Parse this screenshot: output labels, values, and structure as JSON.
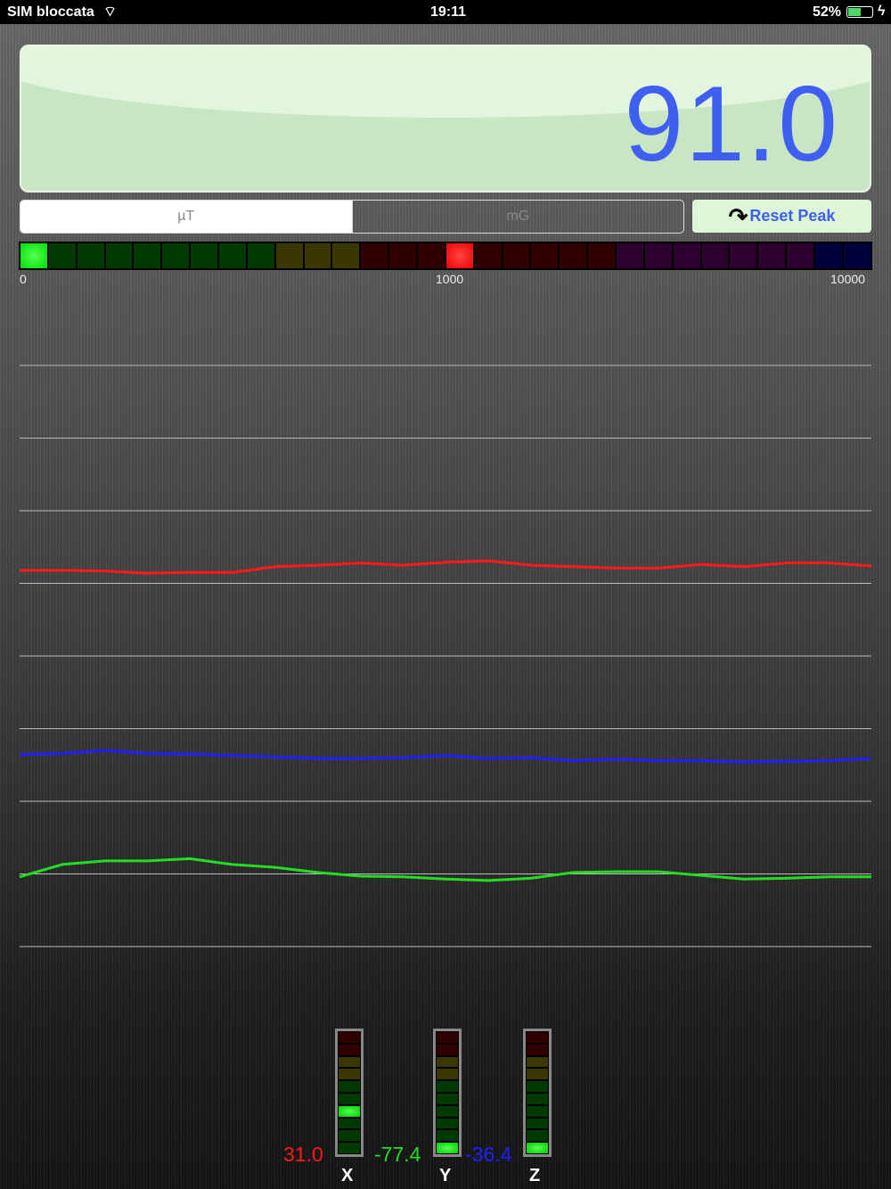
{
  "status": {
    "carrier": "SIM bloccata",
    "time": "19:11",
    "battery": "52%"
  },
  "display": {
    "value": "91.0"
  },
  "units": {
    "options": [
      "µT",
      "mG"
    ],
    "selected": "µT"
  },
  "reset_label": "Reset Peak",
  "level_bar": {
    "segments": [
      "green",
      "green",
      "green",
      "green",
      "green",
      "green",
      "green",
      "green",
      "green",
      "yellow",
      "yellow",
      "yellow",
      "red",
      "red",
      "red",
      "red",
      "red",
      "red",
      "red",
      "red",
      "red",
      "purple",
      "purple",
      "purple",
      "purple",
      "purple",
      "purple",
      "purple",
      "navy",
      "navy"
    ],
    "active_index": 0,
    "peak_index": 15,
    "ticks": [
      "0",
      "1000",
      "10000"
    ]
  },
  "colors": {
    "x": "#ff1a1a",
    "y": "#22dd22",
    "z": "#2020ff",
    "value": "#3f5ff0"
  },
  "chart_data": {
    "type": "line",
    "ylim": [
      0,
      8
    ],
    "gridlines": 9,
    "series": [
      {
        "name": "X",
        "color": "#ff1a1a",
        "values": [
          5.18,
          5.18,
          5.17,
          5.14,
          5.15,
          5.15,
          5.23,
          5.25,
          5.28,
          5.25,
          5.29,
          5.31,
          5.25,
          5.23,
          5.21,
          5.21,
          5.26,
          5.23,
          5.28,
          5.28,
          5.24
        ]
      },
      {
        "name": "Z",
        "color": "#2020ff",
        "values": [
          2.64,
          2.66,
          2.7,
          2.66,
          2.65,
          2.63,
          2.61,
          2.59,
          2.59,
          2.6,
          2.63,
          2.59,
          2.6,
          2.56,
          2.58,
          2.56,
          2.56,
          2.54,
          2.55,
          2.56,
          2.59
        ]
      },
      {
        "name": "Y",
        "color": "#22dd22",
        "values": [
          0.96,
          1.13,
          1.18,
          1.18,
          1.21,
          1.13,
          1.09,
          1.02,
          0.97,
          0.96,
          0.93,
          0.91,
          0.94,
          1.02,
          1.03,
          1.03,
          0.98,
          0.93,
          0.94,
          0.96,
          0.96
        ]
      }
    ]
  },
  "axes": [
    {
      "label": "X",
      "value": "31.0",
      "active_segment": 6
    },
    {
      "label": "Y",
      "value": "-77.4",
      "active_segment": 9
    },
    {
      "label": "Z",
      "value": "-36.4",
      "active_segment": 9
    }
  ]
}
